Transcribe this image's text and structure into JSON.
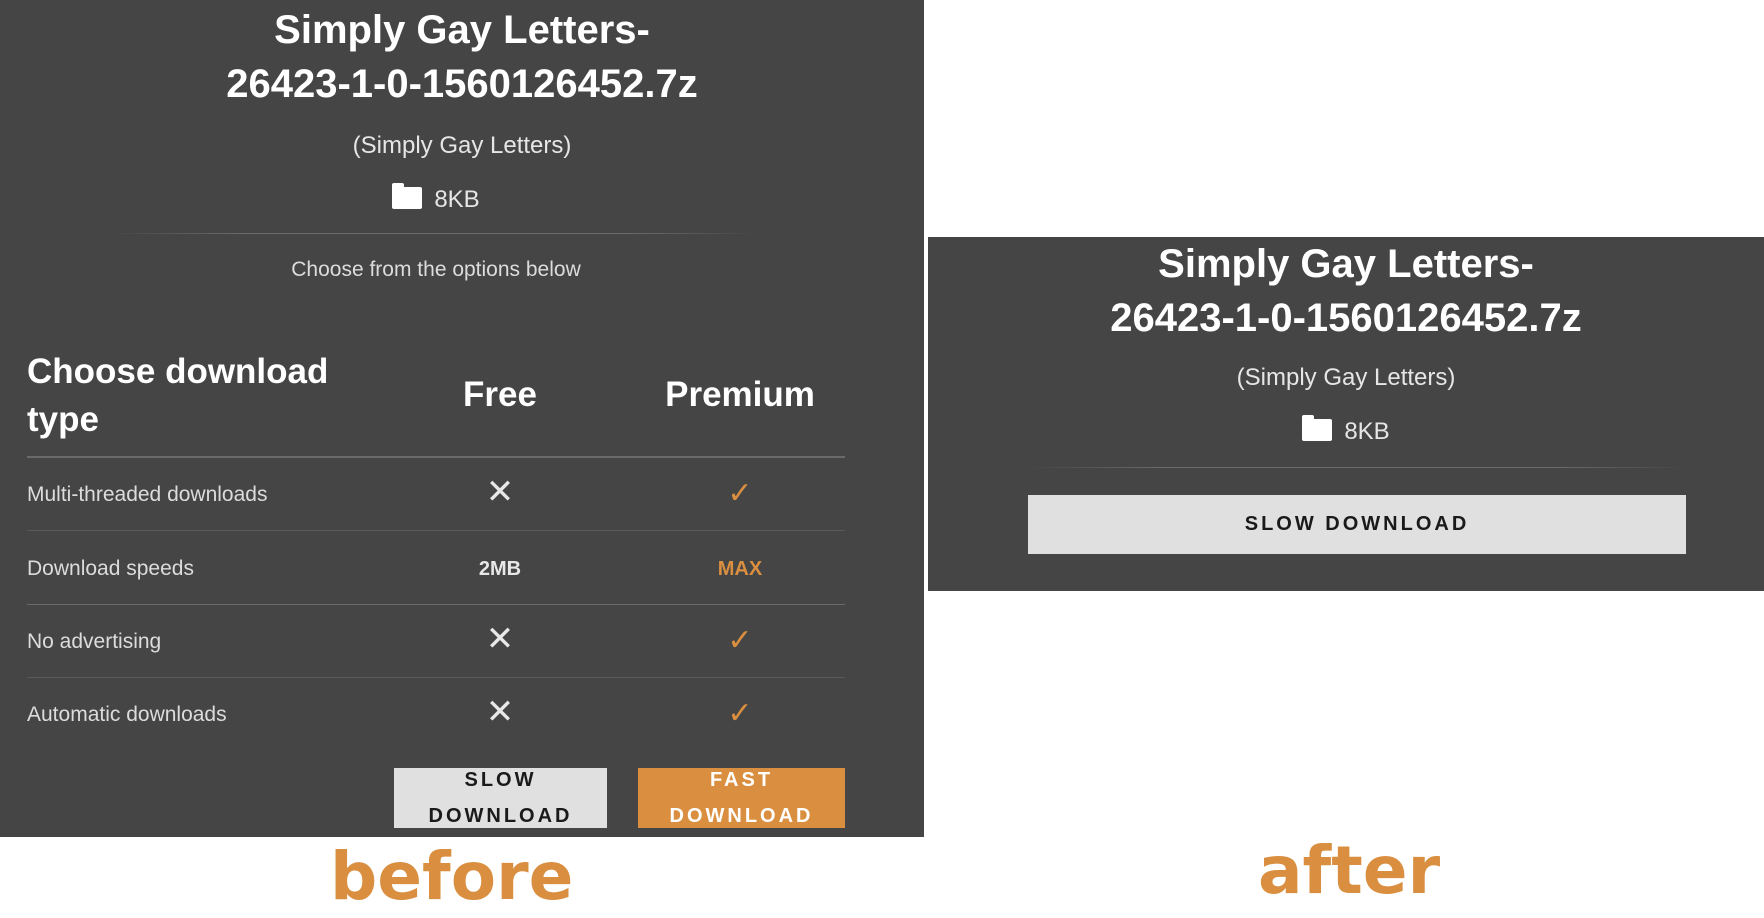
{
  "before": {
    "title_line1": "Simply Gay Letters-",
    "title_line2": "26423-1-0-1560126452.7z",
    "subtitle": "(Simply Gay Letters)",
    "folder_icon": "folder-icon",
    "size": "8KB",
    "choose_text": "Choose from the options below",
    "table": {
      "heading": "Choose download type",
      "col_free": "Free",
      "col_premium": "Premium",
      "rows": [
        {
          "label": "Multi-threaded downloads",
          "free": "✕",
          "premium": "✓"
        },
        {
          "label": "Download speeds",
          "free": "2MB",
          "premium": "MAX"
        },
        {
          "label": "No advertising",
          "free": "✕",
          "premium": "✓"
        },
        {
          "label": "Automatic downloads",
          "free": "✕",
          "premium": "✓"
        }
      ]
    },
    "slow_button": "SLOW DOWNLOAD",
    "fast_button": "FAST DOWNLOAD"
  },
  "after": {
    "title_line1": "Simply Gay Letters-",
    "title_line2": "26423-1-0-1560126452.7z",
    "subtitle": "(Simply Gay Letters)",
    "folder_icon": "folder-icon",
    "size": "8KB",
    "slow_button": "SLOW DOWNLOAD"
  },
  "captions": {
    "before": "before",
    "after": "after"
  },
  "colors": {
    "panel_bg": "#454545",
    "accent": "#d98f3f",
    "button_light": "#e0e0e0"
  }
}
